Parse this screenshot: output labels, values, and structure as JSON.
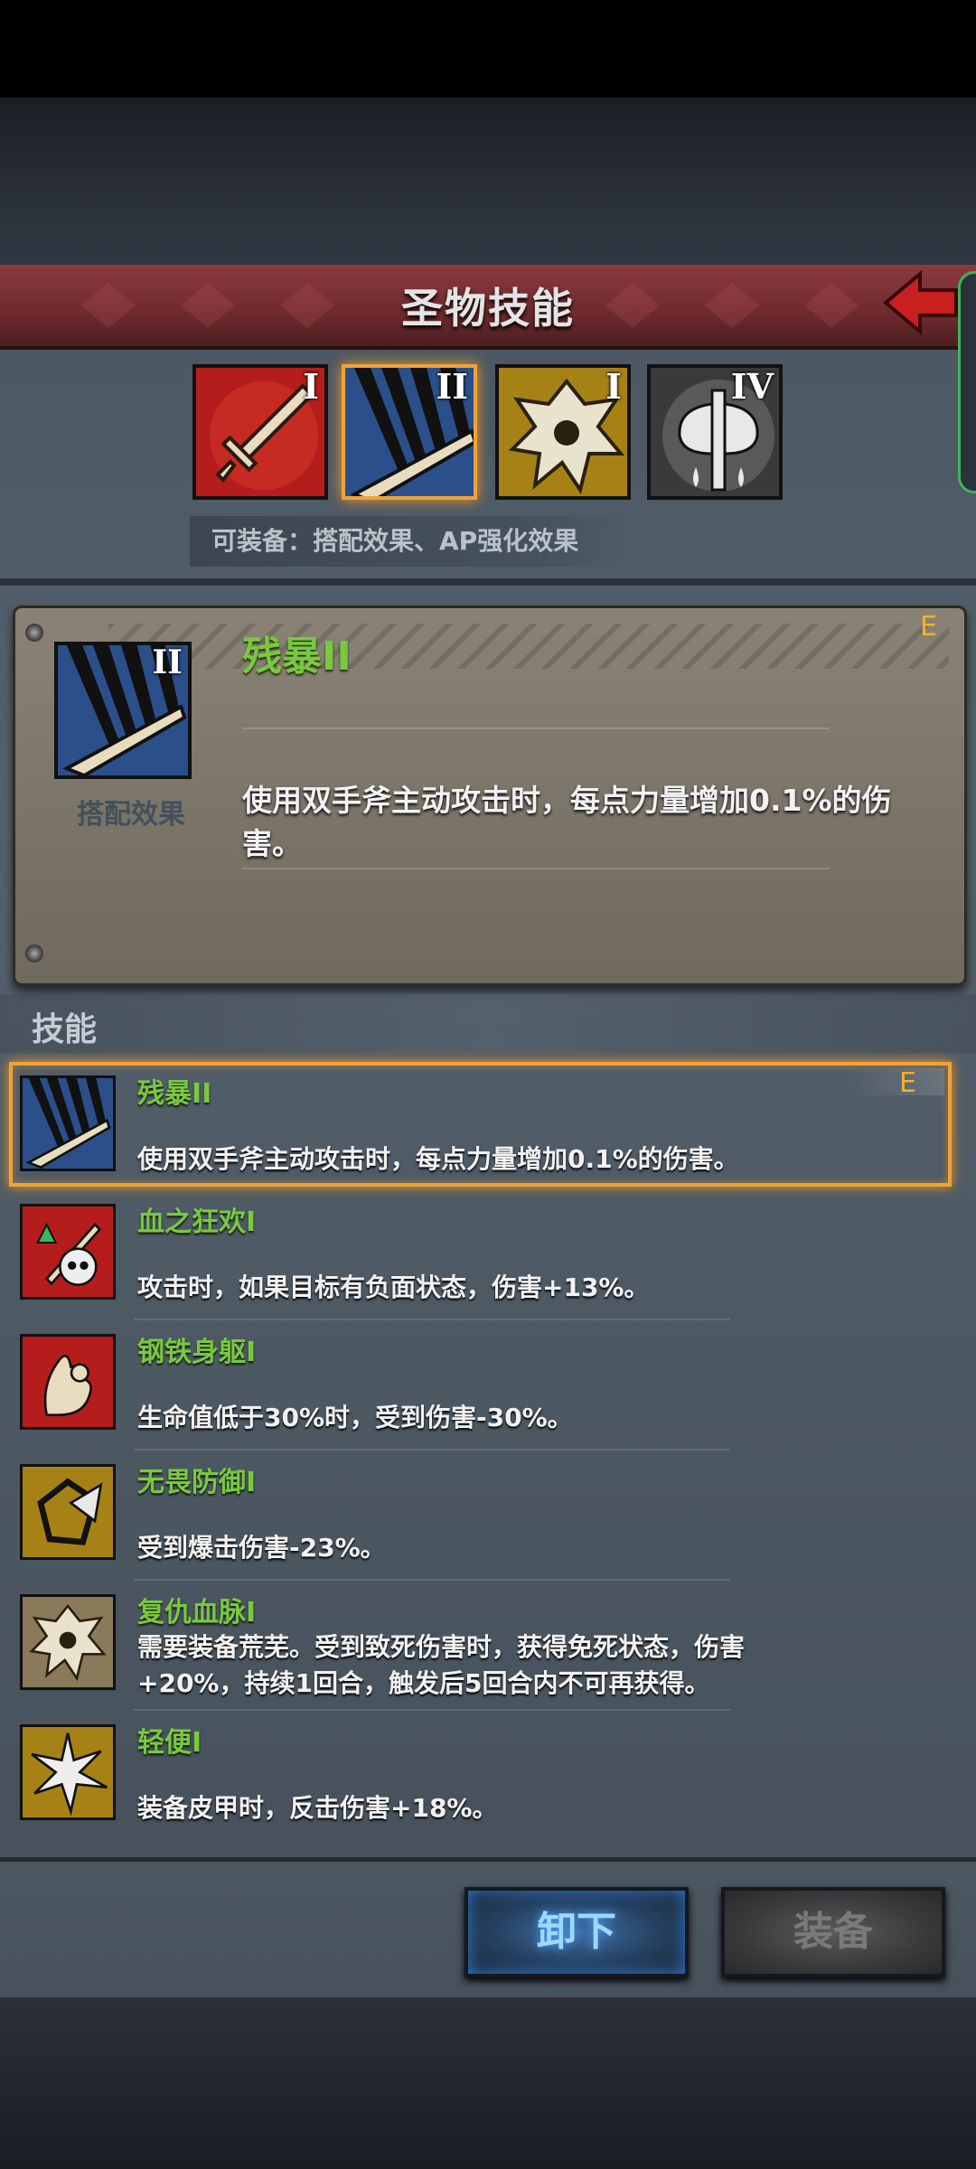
{
  "header": {
    "title": "圣物技能",
    "back_label": "返回"
  },
  "tiers": [
    {
      "numeral": "I",
      "icon": "sword-icon",
      "bg": "#b51d1d"
    },
    {
      "numeral": "II",
      "icon": "blade-slash-icon",
      "bg": "#2b4f8a",
      "selected": true
    },
    {
      "numeral": "I",
      "icon": "beast-icon",
      "bg": "#9c7a17"
    },
    {
      "numeral": "IV",
      "icon": "axe-icon",
      "bg": "#3a3a3a"
    }
  ],
  "equip_hint": "可装备：搭配效果、AP强化效果",
  "detail": {
    "numeral": "II",
    "type_label": "搭配效果",
    "name": "残暴II",
    "grade": "E",
    "description": "使用双手斧主动攻击时，每点力量增加0.1%的伤害。"
  },
  "skills_title": "技能",
  "skills": [
    {
      "name": "残暴II",
      "desc": "使用双手斧主动攻击时，每点力量增加0.1%的伤害。",
      "grade": "E",
      "icon": "blade-slash-icon",
      "selected": true
    },
    {
      "name": "血之狂欢I",
      "desc": "攻击时，如果目标有负面状态，伤害+13%。",
      "icon": "skull-sword-icon"
    },
    {
      "name": "钢铁身躯I",
      "desc": "生命值低于30%时，受到伤害-30%。",
      "icon": "iron-body-icon"
    },
    {
      "name": "无畏防御I",
      "desc": "受到爆击伤害-23%。",
      "icon": "shield-break-icon"
    },
    {
      "name": "复仇血脉I",
      "desc": "需要装备荒芜。受到致死伤害时，获得免死状态，伤害+20%，持续1回合，触发后5回合内不可再获得。",
      "icon": "beast-icon"
    },
    {
      "name": "轻便I",
      "desc": "装备皮甲时，反击伤害+18%。",
      "icon": "light-strike-icon"
    }
  ],
  "buttons": {
    "unequip": "卸下",
    "equip": "装备"
  }
}
